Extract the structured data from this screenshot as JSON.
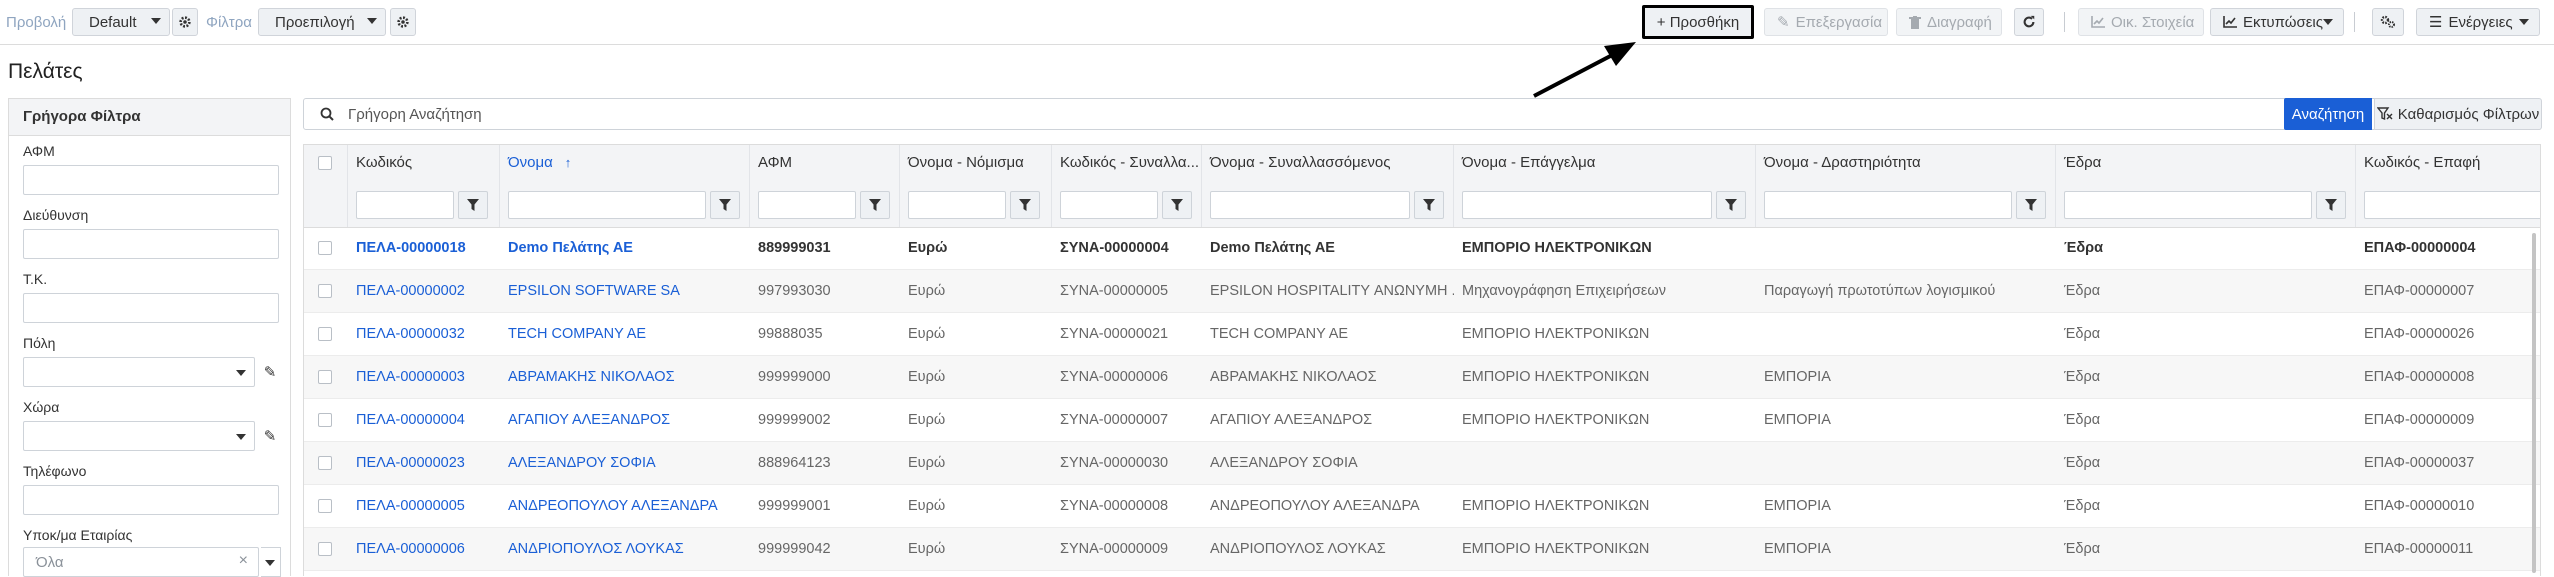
{
  "toolbar": {
    "view_label": "Προβολή",
    "view_value": "Default",
    "filter_label": "Φίλτρα",
    "filter_value": "Προεπιλογή",
    "add": "+ Προσθήκη",
    "edit": "Επεξεργασία",
    "delete": "Διαγραφή",
    "financial": "Οικ. Στοιχεία",
    "prints": "Εκτυπώσεις",
    "actions": "Ενέργειες"
  },
  "page": {
    "title": "Πελάτες"
  },
  "quick_filters": {
    "title": "Γρήγορα Φίλτρα",
    "fields": [
      "ΑΦΜ",
      "Διεύθυνση",
      "Τ.Κ.",
      "Πόλη",
      "Χώρα",
      "Τηλέφωνο",
      "Υποκ/μα Εταιρίας"
    ],
    "branch_placeholder": "Όλα"
  },
  "search": {
    "placeholder": "Γρήγορη Αναζήτηση",
    "search_button": "Αναζήτηση",
    "clear_button": "Καθαρισμός Φίλτρων"
  },
  "grid": {
    "columns": [
      "Κωδικός",
      "Όνομα",
      "ΑΦΜ",
      "Όνομα - Νόμισμα",
      "Κωδικός - Συναλλα...",
      "Όνομα - Συναλλασσόμενος",
      "Όνομα - Επάγγελμα",
      "Όνομα - Δραστηριότητα",
      "Έδρα",
      "Κωδικός - Επαφή"
    ],
    "rows": [
      [
        "ΠΕΛΑ-00000018",
        "Demo Πελάτης ΑΕ",
        "889999031",
        "Ευρώ",
        "ΣΥΝΑ-00000004",
        "Demo Πελάτης ΑΕ",
        "ΕΜΠΟΡΙΟ ΗΛΕΚΤΡΟΝΙΚΩΝ",
        "",
        "Έδρα",
        "ΕΠΑΦ-00000004"
      ],
      [
        "ΠΕΛΑ-00000002",
        "EPSILON SOFTWARE SA",
        "997993030",
        "Ευρώ",
        "ΣΥΝΑ-00000005",
        "EPSILON HOSPITALITY ΑΝΩΝΥΜΗ ...",
        "Μηχανογράφηση Επιχειρήσεων",
        "Παραγωγή πρωτοτύπων λογισμικού",
        "Έδρα",
        "ΕΠΑΦ-00000007"
      ],
      [
        "ΠΕΛΑ-00000032",
        "TECH COMPANY AE",
        "99888035",
        "Ευρώ",
        "ΣΥΝΑ-00000021",
        "TECH COMPANY AE",
        "ΕΜΠΟΡΙΟ ΗΛΕΚΤΡΟΝΙΚΩΝ",
        "",
        "Έδρα",
        "ΕΠΑΦ-00000026"
      ],
      [
        "ΠΕΛΑ-00000003",
        "ΑΒΡΑΜΑΚΗΣ ΝΙΚΟΛΑΟΣ",
        "999999000",
        "Ευρώ",
        "ΣΥΝΑ-00000006",
        "ΑΒΡΑΜΑΚΗΣ ΝΙΚΟΛΑΟΣ",
        "ΕΜΠΟΡΙΟ ΗΛΕΚΤΡΟΝΙΚΩΝ",
        "ΕΜΠΟΡΙΑ",
        "Έδρα",
        "ΕΠΑΦ-00000008"
      ],
      [
        "ΠΕΛΑ-00000004",
        "ΑΓΑΠΙΟΥ ΑΛΕΞΑΝΔΡΟΣ",
        "999999002",
        "Ευρώ",
        "ΣΥΝΑ-00000007",
        "ΑΓΑΠΙΟΥ ΑΛΕΞΑΝΔΡΟΣ",
        "ΕΜΠΟΡΙΟ ΗΛΕΚΤΡΟΝΙΚΩΝ",
        "ΕΜΠΟΡΙΑ",
        "Έδρα",
        "ΕΠΑΦ-00000009"
      ],
      [
        "ΠΕΛΑ-00000023",
        "ΑΛΕΞΑΝΔΡΟΥ ΣΟΦΙΑ",
        "888964123",
        "Ευρώ",
        "ΣΥΝΑ-00000030",
        "ΑΛΕΞΑΝΔΡΟΥ ΣΟΦΙΑ",
        "",
        "",
        "Έδρα",
        "ΕΠΑΦ-00000037"
      ],
      [
        "ΠΕΛΑ-00000005",
        "ΑΝΔΡΕΟΠΟΥΛΟΥ ΑΛΕΞΑΝΔΡΑ",
        "999999001",
        "Ευρώ",
        "ΣΥΝΑ-00000008",
        "ΑΝΔΡΕΟΠΟΥΛΟΥ ΑΛΕΞΑΝΔΡΑ",
        "ΕΜΠΟΡΙΟ ΗΛΕΚΤΡΟΝΙΚΩΝ",
        "ΕΜΠΟΡΙΑ",
        "Έδρα",
        "ΕΠΑΦ-00000010"
      ],
      [
        "ΠΕΛΑ-00000006",
        "ΑΝΔΡΙΟΠΟΥΛΟΣ ΛΟΥΚΑΣ",
        "999999042",
        "Ευρώ",
        "ΣΥΝΑ-00000009",
        "ΑΝΔΡΙΟΠΟΥΛΟΣ ΛΟΥΚΑΣ",
        "ΕΜΠΟΡΙΟ ΗΛΕΚΤΡΟΝΙΚΩΝ",
        "ΕΜΠΟΡΙΑ",
        "Έδρα",
        "ΕΠΑΦ-00000011"
      ]
    ]
  },
  "colors": {
    "accent": "#1a5fd6",
    "header_bg": "#f3f4f6",
    "highlight_border": "#000000"
  }
}
